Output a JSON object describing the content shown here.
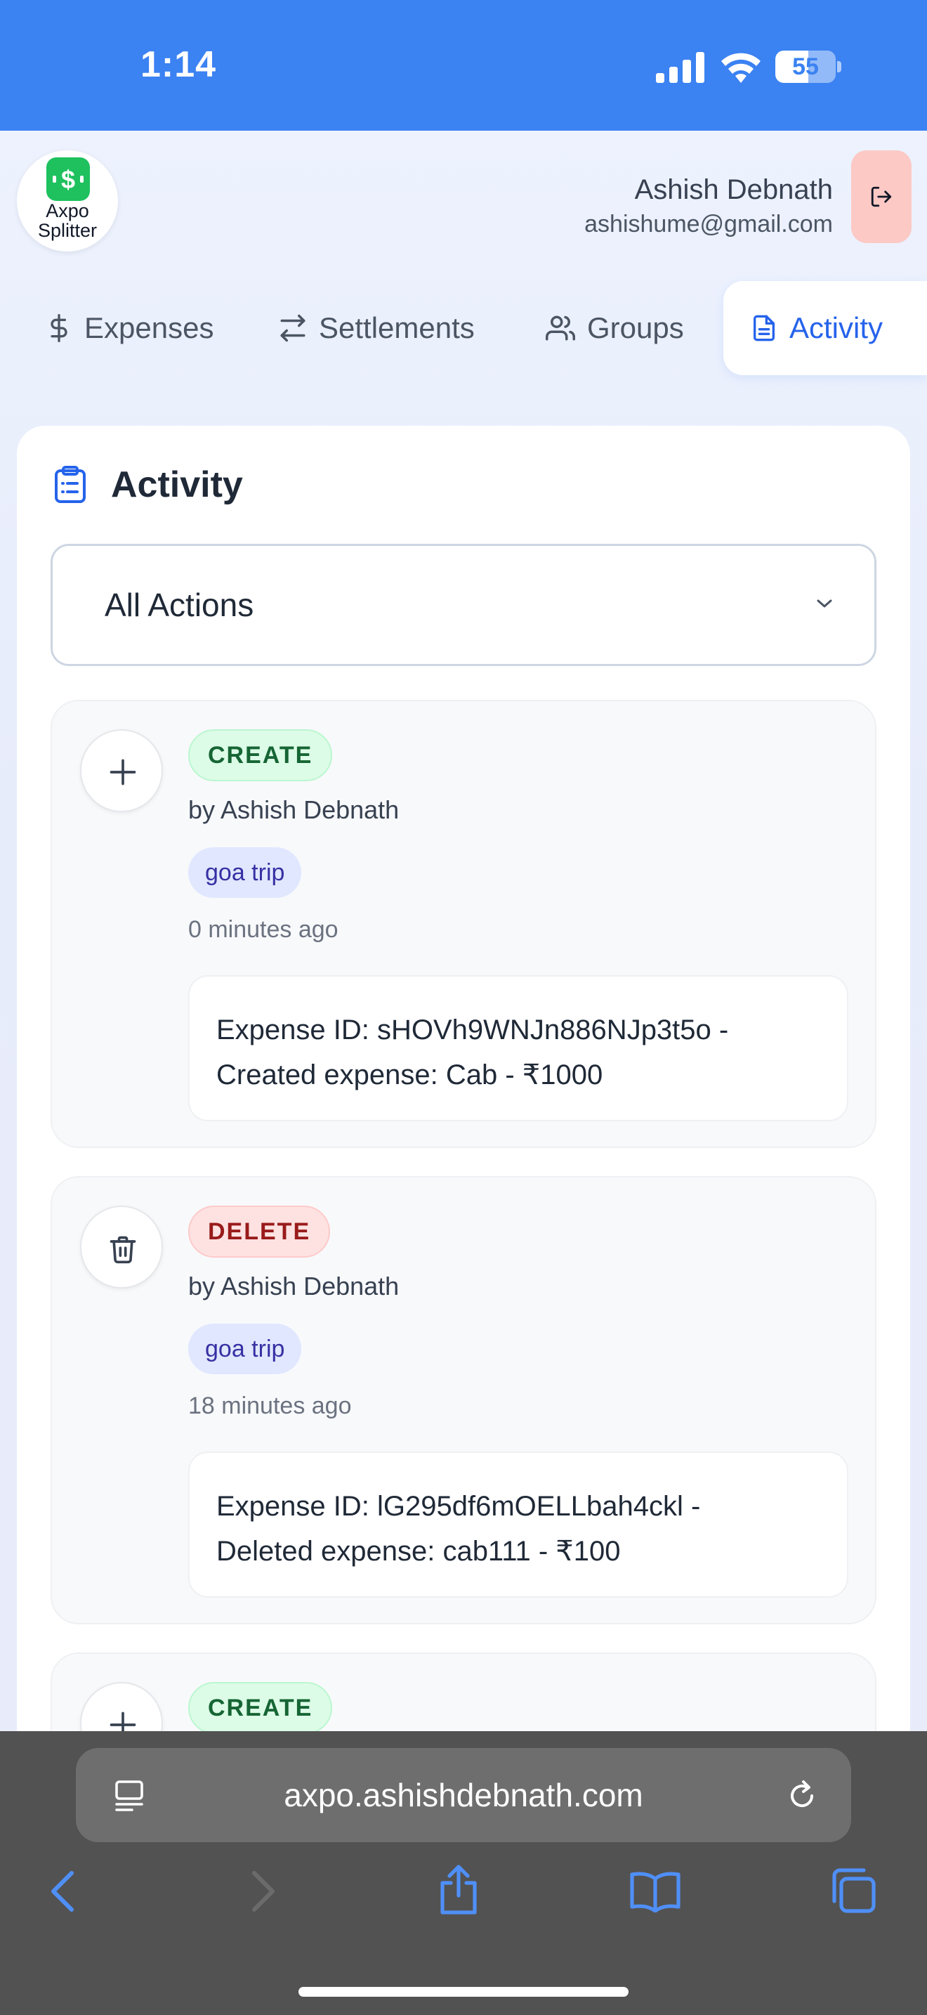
{
  "status_bar": {
    "time": "1:14",
    "battery": "55",
    "battery_level": 0.55
  },
  "header": {
    "logo_text": [
      "Axpo",
      "Splitter"
    ],
    "user_name": "Ashish Debnath",
    "user_email": "ashishume@gmail.com"
  },
  "tabs": [
    {
      "label": "Expenses",
      "icon": "dollar-icon"
    },
    {
      "label": "Settlements",
      "icon": "arrows-exchange-icon"
    },
    {
      "label": "Groups",
      "icon": "users-icon"
    },
    {
      "label": "Activity",
      "icon": "document-icon",
      "active": true
    }
  ],
  "activity": {
    "title": "Activity",
    "filter_value": "All Actions",
    "items": [
      {
        "action": "CREATE",
        "by": "by Ashish Debnath",
        "group": "goa trip",
        "time": "0 minutes ago",
        "detail_line1": "Expense ID: sHOVh9WNJn886NJp3t5o -",
        "detail_line2": "Created expense: Cab - ₹1000"
      },
      {
        "action": "DELETE",
        "by": "by Ashish Debnath",
        "group": "goa trip",
        "time": "18 minutes ago",
        "detail_line1": "Expense ID: lG295df6mOELLbah4ckl -",
        "detail_line2": "Deleted expense: cab111 - ₹100"
      },
      {
        "action": "CREATE"
      }
    ]
  },
  "browser": {
    "url": "axpo.ashishdebnath.com"
  },
  "colors": {
    "accent": "#3b82f2",
    "active_tab": "#2563eb",
    "create_badge": "#dcfce7",
    "delete_badge": "#fee2e2",
    "group_tag": "#e0e7ff"
  }
}
